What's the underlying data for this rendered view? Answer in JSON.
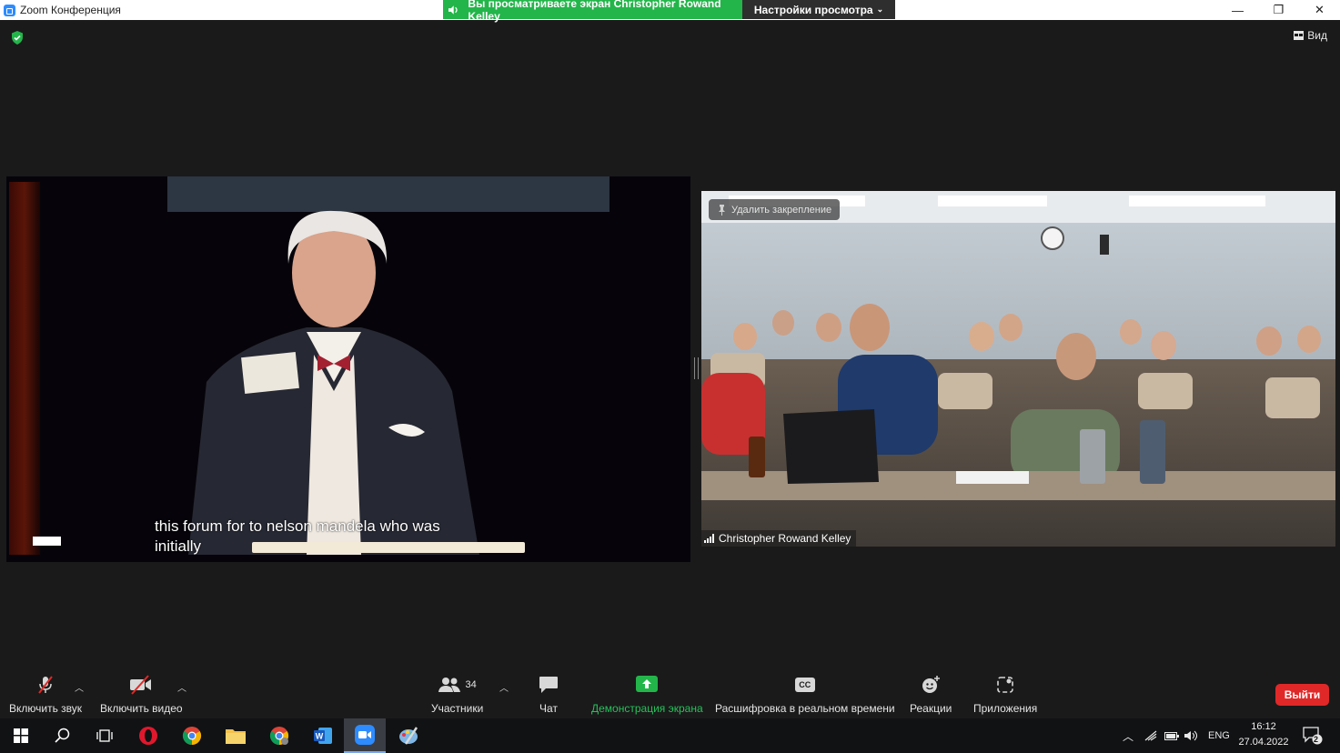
{
  "window": {
    "title": "Zoom Конференция",
    "share_banner": "Вы просматриваете экран Christopher Rowand Kelley",
    "view_options": "Настройки просмотра",
    "controls": [
      "—",
      "❐",
      "✕"
    ]
  },
  "top_right": {
    "view_label": "Вид"
  },
  "left_video": {
    "subtitle_line1": "this forum for to nelson mandela who was",
    "subtitle_line2": "initially"
  },
  "right_video": {
    "unpin_label": "Удалить закрепление",
    "participant_name": "Christopher Rowand Kelley"
  },
  "toolbar": {
    "audio_label": "Включить звук",
    "video_label": "Включить видео",
    "participants_label": "Участники",
    "participants_count": "34",
    "chat_label": "Чат",
    "share_label": "Демонстрация экрана",
    "captions_label": "Расшифровка в реальном времени",
    "captions_icon_text": "CC",
    "reactions_label": "Реакции",
    "apps_label": "Приложения",
    "leave_label": "Выйти"
  },
  "taskbar": {
    "language": "ENG",
    "time": "16:12",
    "date": "27.04.2022",
    "notification_count": "2"
  },
  "colors": {
    "share_green": "#23b54a",
    "leave_red": "#e02828",
    "zoom_blue": "#2d8cff"
  }
}
